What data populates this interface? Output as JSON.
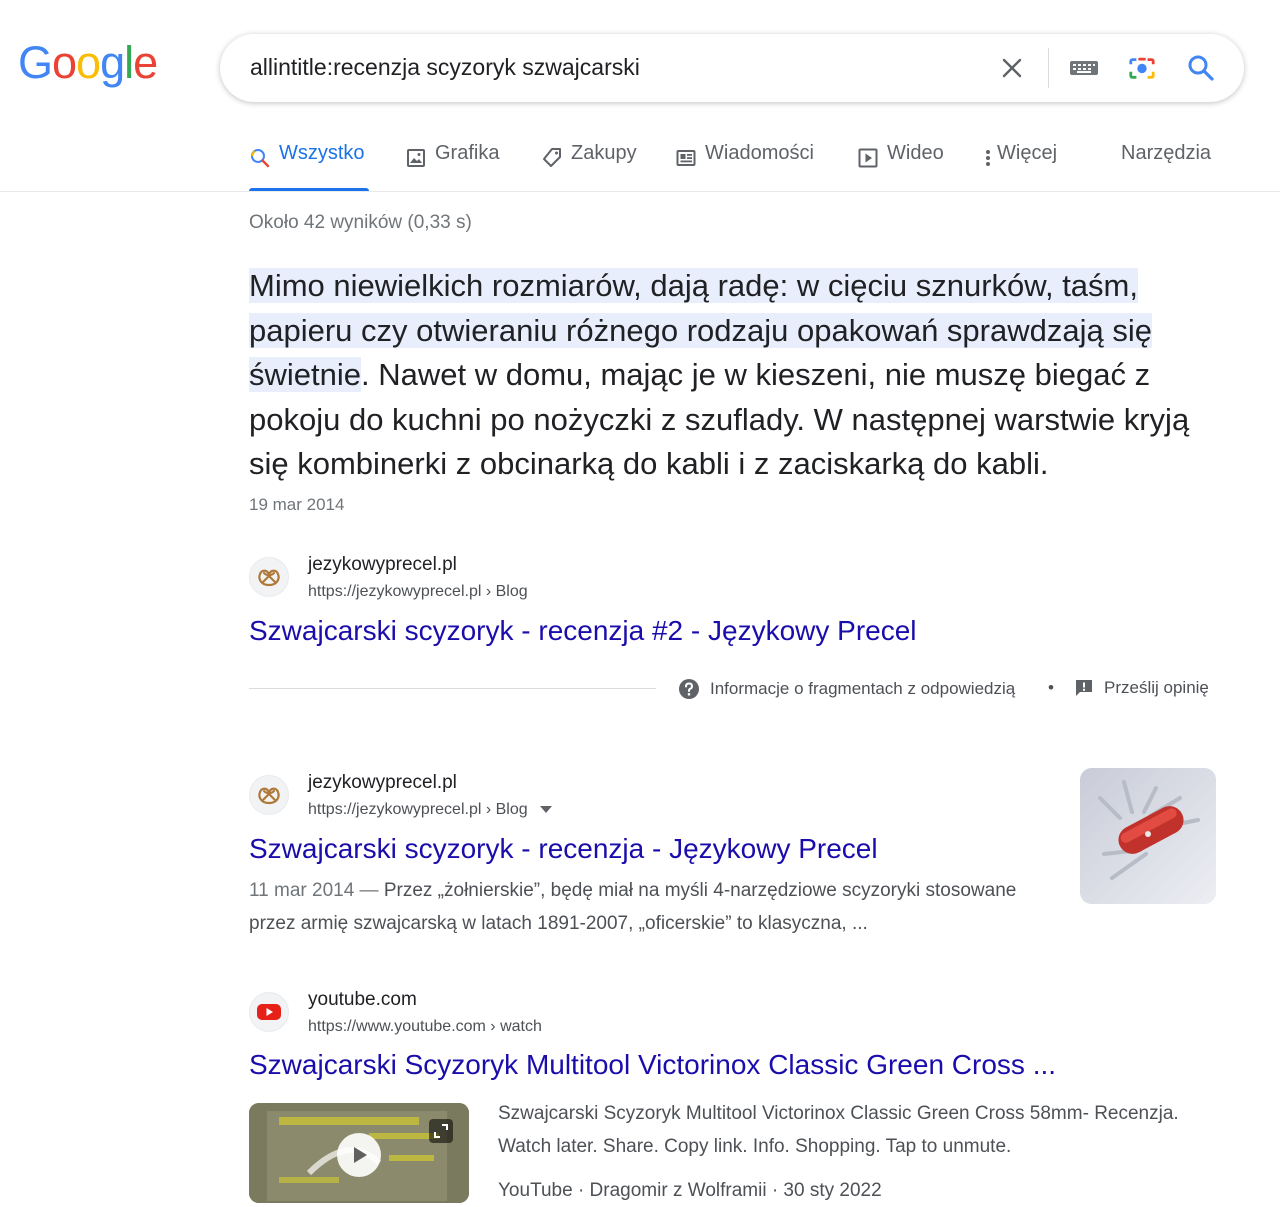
{
  "colors": {
    "accent": "#1a73e8",
    "link": "#1a0dab",
    "text": "#202124",
    "muted": "#70757a",
    "highlight": "#e8eefc"
  },
  "logo": {
    "text": "Google"
  },
  "search": {
    "query": "allintitle:recenzja scyzoryk szwajcarski"
  },
  "icons": [
    "close-icon",
    "keyboard-icon",
    "camera-icon",
    "search-icon"
  ],
  "tabs": [
    {
      "label": "Wszystko",
      "icon": "search-icon",
      "active": true
    },
    {
      "label": "Grafika",
      "icon": "image-icon",
      "active": false
    },
    {
      "label": "Zakupy",
      "icon": "tag-icon",
      "active": false
    },
    {
      "label": "Wiadomości",
      "icon": "news-icon",
      "active": false
    },
    {
      "label": "Wideo",
      "icon": "play-icon",
      "active": false
    },
    {
      "label": "Więcej",
      "icon": "more-vert-icon",
      "active": false
    }
  ],
  "tools_label": "Narzędzia",
  "stats": "Około 42 wyników (0,33 s)",
  "featured": {
    "highlight": "Mimo niewielkich rozmiarów, dają radę: w cięciu sznurków, taśm, papieru czy otwieraniu różnego rodzaju opakowań sprawdzają się świetnie",
    "rest": ". Nawet w domu, mając je w kieszeni, nie muszę biegać z pokoju do kuchni po nożyczki z szuflady. W następnej warstwie kryją się kombinerki z obcinarką do kabli i z zaciskarką do kabli.",
    "date": "19 mar 2014",
    "site": "jezykowyprecel.pl",
    "url": "https://jezykowyprecel.pl › Blog",
    "title": "Szwajcarski scyzoryk - recenzja #2 - Językowy Precel"
  },
  "feedback": {
    "about": "Informacje o fragmentach z odpowiedzią",
    "sep": "•",
    "send": "Prześlij opinię"
  },
  "results": [
    {
      "site": "jezykowyprecel.pl",
      "url": "https://jezykowyprecel.pl › Blog",
      "title": "Szwajcarski scyzoryk - recenzja - Językowy Precel",
      "date": "11 mar 2014 — ",
      "desc": "Przez „żołnierskie”, będę miał na myśli 4-narzędziowe scyzoryki stosowane przez armię szwajcarską w latach 1891-2007, „oficerskie” to klasyczna, ..."
    },
    {
      "site": "youtube.com",
      "url": "https://www.youtube.com › watch",
      "title": "Szwajcarski Scyzoryk Multitool Victorinox Classic Green Cross ...",
      "desc": "Szwajcarski Scyzoryk Multitool Victorinox Classic Green Cross 58mm- Recenzja. Watch later. Share. Copy link. Info. Shopping. Tap to unmute.",
      "meta": "YouTube · Dragomir z Wolframii · 30 sty 2022"
    }
  ]
}
